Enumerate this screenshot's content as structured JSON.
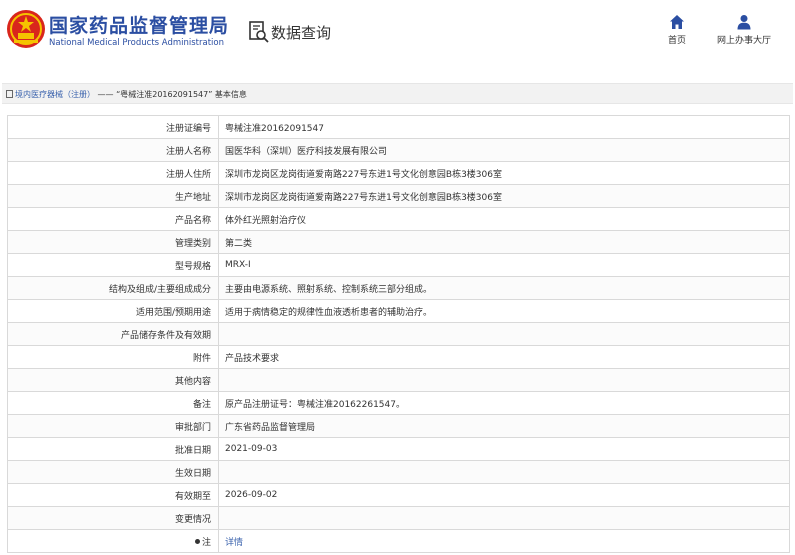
{
  "header": {
    "site_name_cn": "国家药品监督管理局",
    "site_name_en": "National Medical Products Administration",
    "query_title": "数据查询",
    "nav": [
      {
        "label": "首页",
        "icon": "home-icon"
      },
      {
        "label": "网上办事大厅",
        "icon": "user-icon"
      }
    ]
  },
  "breadcrumb": {
    "link_text": "境内医疗器械（注册）",
    "separator": "——",
    "current": "“粤械注准20162091547” 基本信息"
  },
  "colors": {
    "brand_blue": "#2b4ea2",
    "link_blue": "#3b63ad",
    "border": "#d9d9d9"
  },
  "record": [
    {
      "key": "注册证编号",
      "value": "粤械注准20162091547"
    },
    {
      "key": "注册人名称",
      "value": "国医华科（深圳）医疗科技发展有限公司"
    },
    {
      "key": "注册人住所",
      "value": "深圳市龙岗区龙岗街道爱南路227号东进1号文化创意园B栋3楼306室"
    },
    {
      "key": "生产地址",
      "value": "深圳市龙岗区龙岗街道爱南路227号东进1号文化创意园B栋3楼306室"
    },
    {
      "key": "产品名称",
      "value": "体外红光照射治疗仪"
    },
    {
      "key": "管理类别",
      "value": "第二类"
    },
    {
      "key": "型号规格",
      "value": "MRX-I"
    },
    {
      "key": "结构及组成/主要组成成分",
      "value": "主要由电源系统、照射系统、控制系统三部分组成。"
    },
    {
      "key": "适用范围/预期用途",
      "value": "适用于病情稳定的规律性血液透析患者的辅助治疗。"
    },
    {
      "key": "产品储存条件及有效期",
      "value": ""
    },
    {
      "key": "附件",
      "value": "产品技术要求"
    },
    {
      "key": "其他内容",
      "value": ""
    },
    {
      "key": "备注",
      "value": "原产品注册证号：粤械注准20162261547。"
    },
    {
      "key": "审批部门",
      "value": "广东省药品监督管理局"
    },
    {
      "key": "批准日期",
      "value": "2021-09-03"
    },
    {
      "key": "生效日期",
      "value": ""
    },
    {
      "key": "有效期至",
      "value": "2026-09-02"
    },
    {
      "key": "变更情况",
      "value": ""
    }
  ],
  "note_row": {
    "key": "注",
    "value": "详情"
  }
}
